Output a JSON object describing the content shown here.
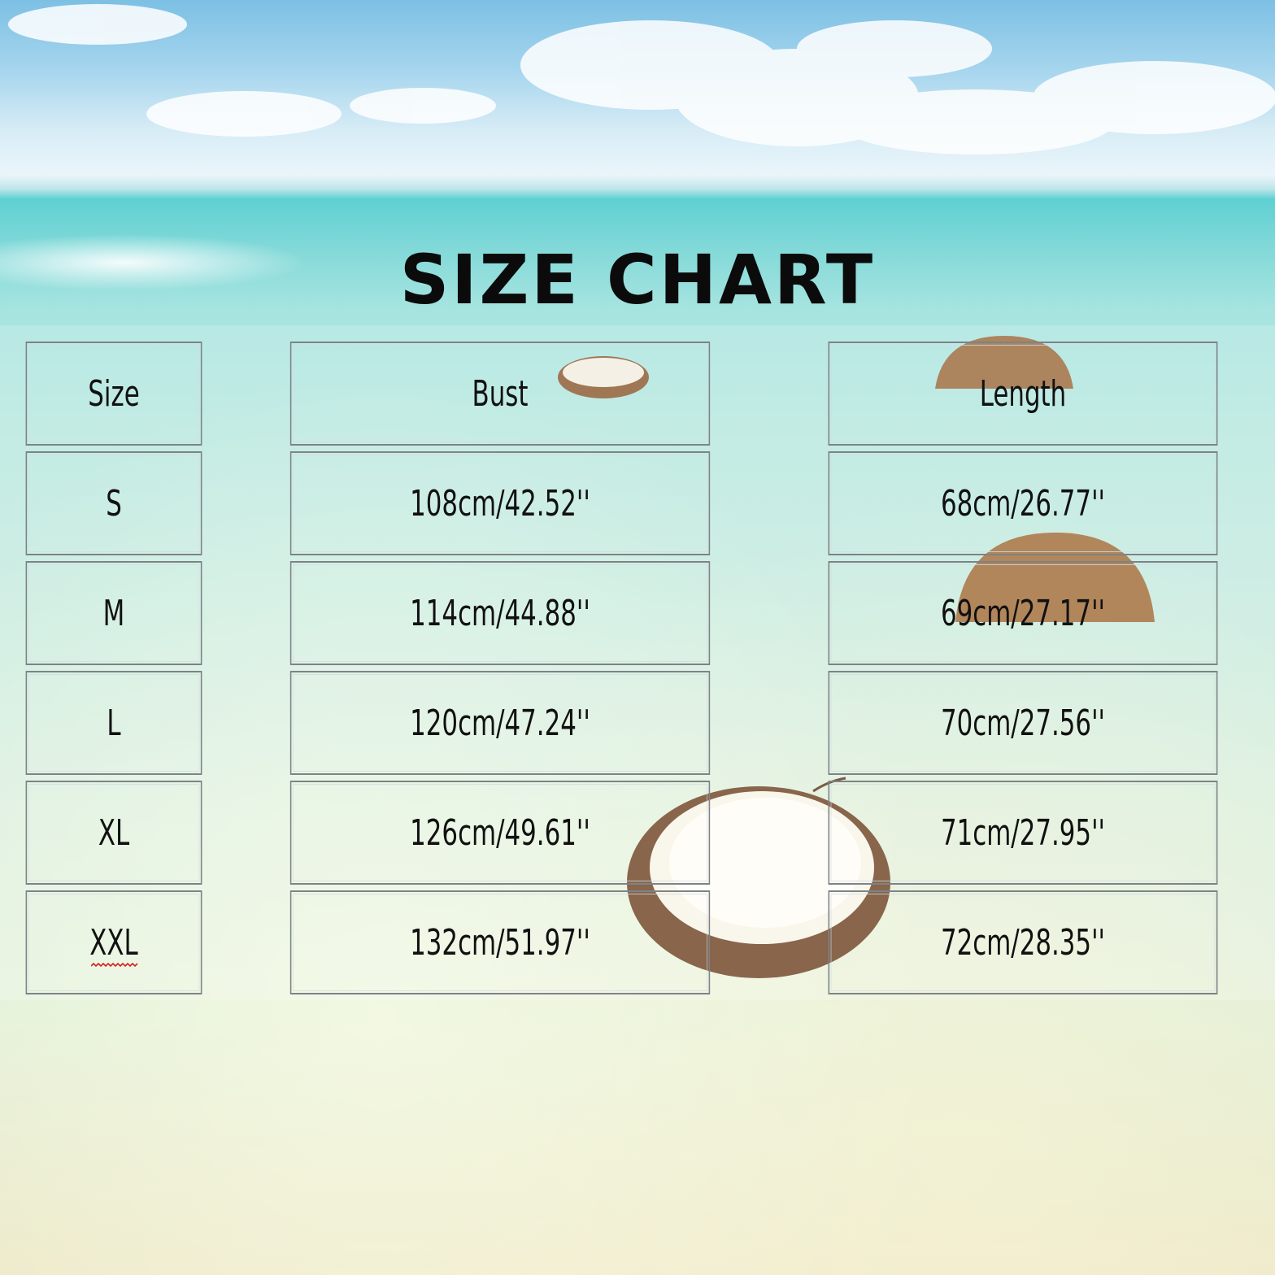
{
  "title": "SIZE CHART",
  "columns": [
    "Size",
    "Bust",
    "Length"
  ],
  "rows": [
    {
      "size": "S",
      "bust": "108cm/42.52''",
      "length": "68cm/26.77''"
    },
    {
      "size": "M",
      "bust": "114cm/44.88''",
      "length": "69cm/27.17''"
    },
    {
      "size": "L",
      "bust": "120cm/47.24''",
      "length": "70cm/27.56''"
    },
    {
      "size": "XL",
      "bust": "126cm/49.61''",
      "length": "71cm/27.95''"
    },
    {
      "size": "XXL",
      "bust": "132cm/51.97''",
      "length": "72cm/28.35''"
    }
  ],
  "colors": {
    "text": "#111111",
    "border": "#7d8387",
    "sea": "#7fd8d8",
    "sky": "#7cc0e4"
  }
}
